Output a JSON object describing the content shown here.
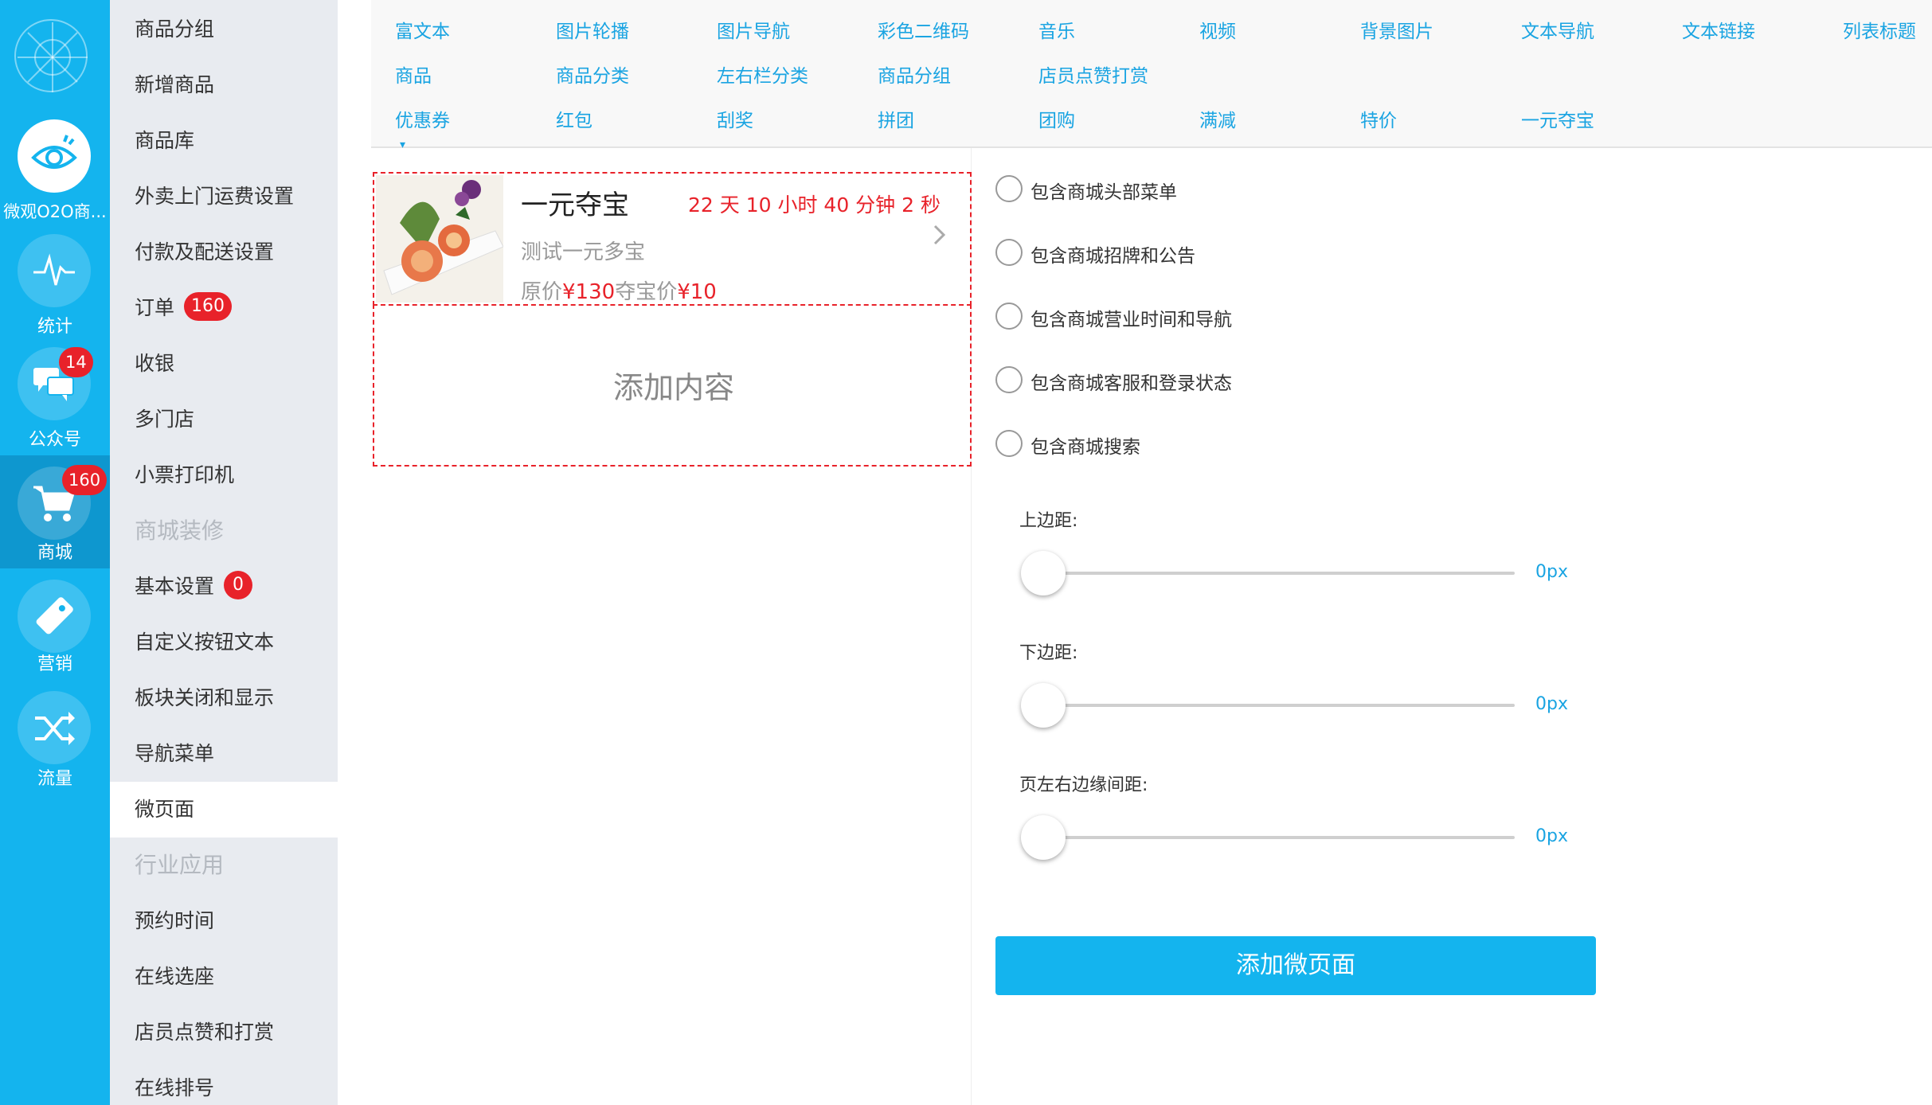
{
  "rail": {
    "app_label": "微观O2O商...",
    "items": [
      {
        "label": "统计",
        "icon": "pulse-icon"
      },
      {
        "label": "公众号",
        "icon": "chat-icon",
        "badge": "14"
      },
      {
        "label": "商城",
        "icon": "cart-icon",
        "badge": "160"
      },
      {
        "label": "营销",
        "icon": "tag-icon"
      },
      {
        "label": "流量",
        "icon": "shuffle-icon"
      }
    ]
  },
  "subnav": {
    "items": [
      {
        "label": "商品分组"
      },
      {
        "label": "新增商品"
      },
      {
        "label": "商品库"
      },
      {
        "label": "外卖上门运费设置"
      },
      {
        "label": "付款及配送设置"
      },
      {
        "label": "订单",
        "badge": "160"
      },
      {
        "label": "收银"
      },
      {
        "label": "多门店"
      },
      {
        "label": "小票打印机"
      },
      {
        "label": "商城装修",
        "group": true
      },
      {
        "label": "基本设置",
        "badge": "0"
      },
      {
        "label": "自定义按钮文本"
      },
      {
        "label": "板块关闭和显示"
      },
      {
        "label": "导航菜单"
      },
      {
        "label": "微页面",
        "active": true
      },
      {
        "label": "行业应用",
        "group": true
      },
      {
        "label": "预约时间"
      },
      {
        "label": "在线选座"
      },
      {
        "label": "店员点赞和打赏"
      },
      {
        "label": "在线排号"
      }
    ]
  },
  "components": {
    "row1": [
      "富文本",
      "图片轮播",
      "图片导航",
      "彩色二维码",
      "音乐",
      "视频",
      "背景图片",
      "文本导航",
      "文本链接",
      "列表标题"
    ],
    "row2": [
      "商品",
      "商品分类",
      "左右栏分类",
      "商品分组",
      "店员点赞打赏"
    ],
    "row3": [
      "优惠券",
      "红包",
      "刮奖",
      "拼团",
      "团购",
      "满减",
      "特价",
      "一元夺宝"
    ]
  },
  "preview": {
    "goods": {
      "title": "一元夺宝",
      "countdown": "22 天 10 小时 40 分钟 2 秒",
      "subtitle": "测试一元多宝",
      "price_prefix": "原价",
      "original_price": "¥130",
      "price_mid": "夺宝价",
      "deal_price": "¥10"
    },
    "add_content": "添加内容"
  },
  "settings": {
    "options": [
      "包含商城头部菜单",
      "包含商城招牌和公告",
      "包含商城营业时间和导航",
      "包含商城客服和登录状态",
      "包含商城搜索"
    ],
    "sliders": [
      {
        "label": "上边距:",
        "value": "0px"
      },
      {
        "label": "下边距:",
        "value": "0px"
      },
      {
        "label": "页左右边缘间距:",
        "value": "0px"
      }
    ],
    "submit": "添加微页面"
  },
  "colors": {
    "primary": "#14b4ee",
    "badge": "#e8222a",
    "link": "#1aa4e2",
    "subnav_bg": "#e8ebf0"
  }
}
